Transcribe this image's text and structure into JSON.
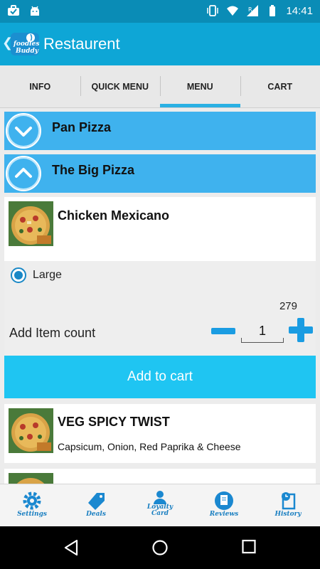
{
  "status_bar": {
    "time": "14:41",
    "left_icons": [
      "briefcase-icon",
      "android-icon"
    ],
    "right_icons": [
      "vibrate-icon",
      "wifi-icon",
      "signal-icon",
      "battery-icon"
    ]
  },
  "app_bar": {
    "title": "Restaurent",
    "back_icon": "chevron-left-icon",
    "logo_text": "foodies Buddy"
  },
  "tabs": [
    {
      "label": "INFO",
      "active": false
    },
    {
      "label": "QUICK MENU",
      "active": false
    },
    {
      "label": "MENU",
      "active": true
    },
    {
      "label": "CART",
      "active": false
    }
  ],
  "categories": [
    {
      "label": "Pan Pizza",
      "icon": "chevron-down-icon",
      "expanded": false
    },
    {
      "label": "The Big Pizza",
      "icon": "chevron-up-icon",
      "expanded": true
    }
  ],
  "items": [
    {
      "name": "Chicken Mexicano",
      "size_option": "Large",
      "size_selected": true,
      "price": "279",
      "count_label": "Add Item count",
      "quantity": "1",
      "add_button": "Add to cart"
    },
    {
      "name": "VEG SPICY TWIST",
      "description": "Capsicum, Onion, Red Paprika & Cheese"
    }
  ],
  "bottom_nav": [
    {
      "label": "Settings",
      "icon": "gear-icon"
    },
    {
      "label": "Deals",
      "icon": "tag-icon"
    },
    {
      "label": "Loyalty Card",
      "icon": "person-icon"
    },
    {
      "label": "Reviews",
      "icon": "document-icon"
    },
    {
      "label": "History",
      "icon": "clock-document-icon"
    }
  ],
  "colors": {
    "status_bar": "#0a8cb6",
    "app_bar": "#0ea6d6",
    "category": "#3fb2ee",
    "add_button": "#1fc5f2",
    "stepper": "#1a9ce2"
  }
}
